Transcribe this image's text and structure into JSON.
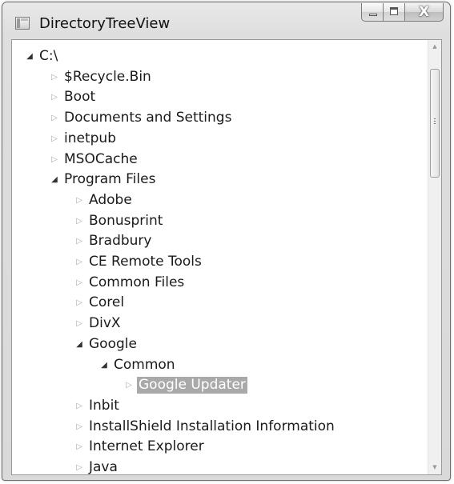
{
  "window": {
    "title": "DirectoryTreeView",
    "icon": "application-window-icon",
    "caption_icons": [
      "minimize-icon",
      "maximize-icon",
      "close-icon"
    ],
    "close_glyph": "X"
  },
  "tree": {
    "expanded_glyph": "◢",
    "collapsed_glyph": "▷",
    "selection_color": "#a9a9a9",
    "rows": [
      {
        "label": "C:\\",
        "depth": 0,
        "state": "expanded"
      },
      {
        "label": "$Recycle.Bin",
        "depth": 1,
        "state": "collapsed"
      },
      {
        "label": "Boot",
        "depth": 1,
        "state": "collapsed"
      },
      {
        "label": "Documents and Settings",
        "depth": 1,
        "state": "collapsed"
      },
      {
        "label": "inetpub",
        "depth": 1,
        "state": "collapsed"
      },
      {
        "label": "MSOCache",
        "depth": 1,
        "state": "collapsed"
      },
      {
        "label": "Program Files",
        "depth": 1,
        "state": "expanded"
      },
      {
        "label": "Adobe",
        "depth": 2,
        "state": "collapsed"
      },
      {
        "label": "Bonusprint",
        "depth": 2,
        "state": "collapsed"
      },
      {
        "label": "Bradbury",
        "depth": 2,
        "state": "collapsed"
      },
      {
        "label": "CE Remote Tools",
        "depth": 2,
        "state": "collapsed"
      },
      {
        "label": "Common Files",
        "depth": 2,
        "state": "collapsed"
      },
      {
        "label": "Corel",
        "depth": 2,
        "state": "collapsed"
      },
      {
        "label": "DivX",
        "depth": 2,
        "state": "collapsed"
      },
      {
        "label": "Google",
        "depth": 2,
        "state": "expanded"
      },
      {
        "label": "Common",
        "depth": 3,
        "state": "expanded"
      },
      {
        "label": "Google Updater",
        "depth": 4,
        "state": "collapsed",
        "selected": true
      },
      {
        "label": "Inbit",
        "depth": 2,
        "state": "collapsed"
      },
      {
        "label": "InstallShield Installation Information",
        "depth": 2,
        "state": "collapsed"
      },
      {
        "label": "Internet Explorer",
        "depth": 2,
        "state": "collapsed"
      },
      {
        "label": "Java",
        "depth": 2,
        "state": "collapsed"
      }
    ]
  },
  "scrollbar": {
    "up_icon": "scroll-up-arrow-icon",
    "down_icon": "scroll-down-arrow-icon",
    "up_glyph": "▲",
    "down_glyph": "▼",
    "position_fraction": 0.0
  }
}
